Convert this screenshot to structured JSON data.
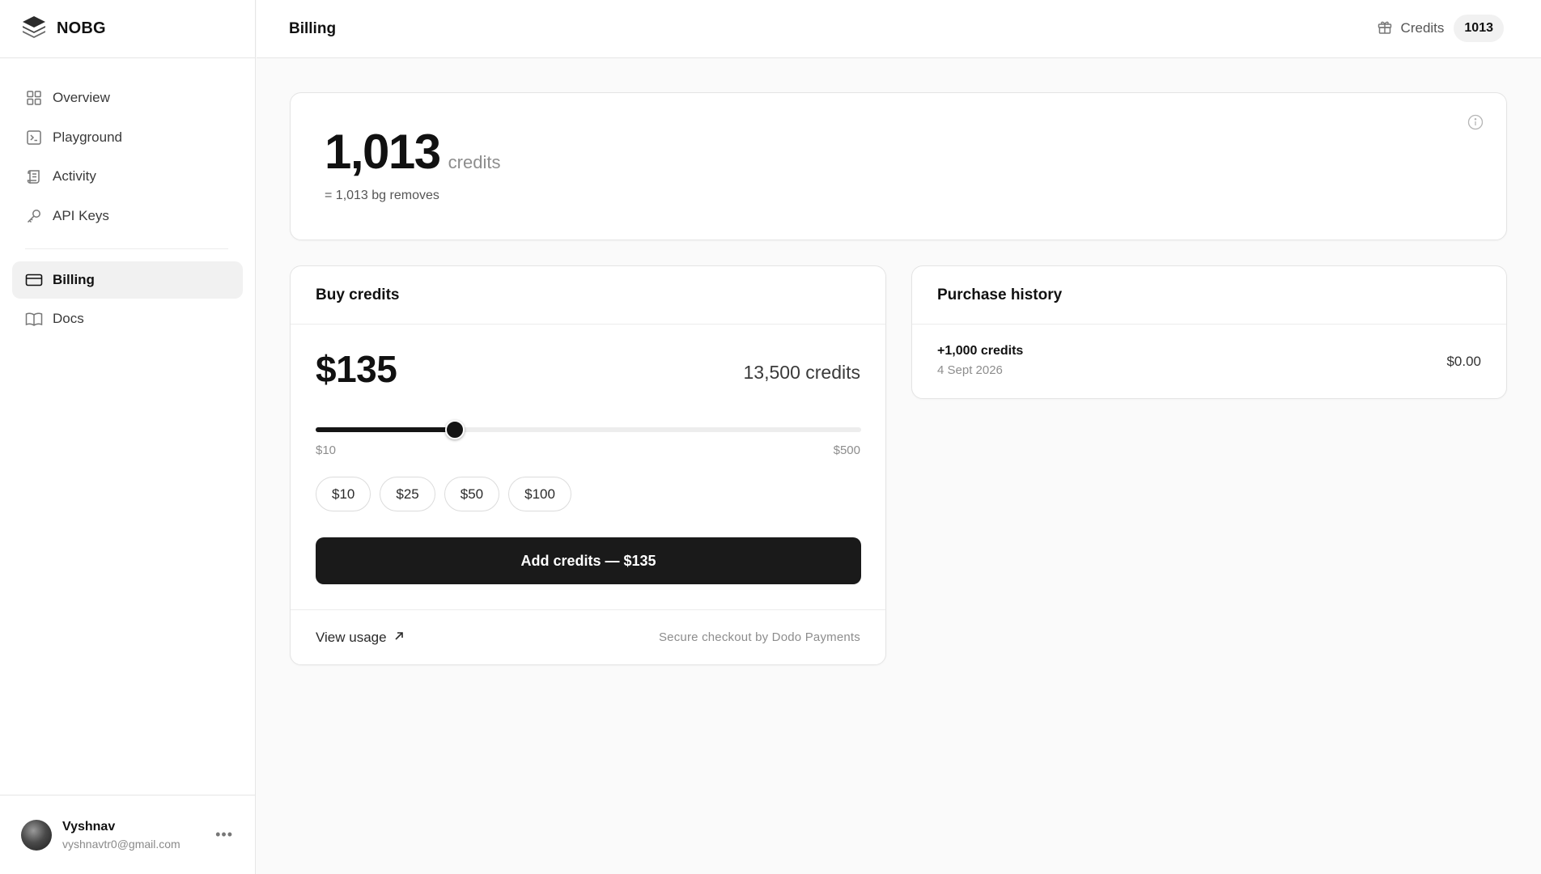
{
  "brand": {
    "name": "NOBG"
  },
  "sidebar": {
    "items": [
      {
        "label": "Overview",
        "icon": "grid-icon"
      },
      {
        "label": "Playground",
        "icon": "terminal-icon"
      },
      {
        "label": "Activity",
        "icon": "scroll-icon"
      },
      {
        "label": "API Keys",
        "icon": "key-icon"
      },
      {
        "label": "Billing",
        "icon": "credit-card-icon",
        "active": true
      },
      {
        "label": "Docs",
        "icon": "book-icon"
      }
    ],
    "user": {
      "name": "Vyshnav",
      "email": "vyshnavtr0@gmail.com"
    }
  },
  "header": {
    "title": "Billing",
    "credits_label": "Credits",
    "credits_value": "1013"
  },
  "balance": {
    "value": "1,013",
    "unit": "credits",
    "subtext": "= 1,013 bg removes"
  },
  "buy": {
    "title": "Buy credits",
    "amount": "$135",
    "credits": "13,500 credits",
    "slider": {
      "min_label": "$10",
      "max_label": "$500",
      "min": 10,
      "max": 500,
      "value": 135
    },
    "presets": [
      "$10",
      "$25",
      "$50",
      "$100"
    ],
    "button_label": "Add credits — $135",
    "view_usage": "View usage",
    "secure_note": "Secure checkout by Dodo Payments"
  },
  "history": {
    "title": "Purchase history",
    "rows": [
      {
        "title": "+1,000 credits",
        "date": "4 Sept 2026",
        "amount": "$0.00"
      }
    ]
  },
  "colors": {
    "accent": "#1a1a1a",
    "active_bg": "#f1f1f1",
    "muted": "#8d8d8d"
  }
}
